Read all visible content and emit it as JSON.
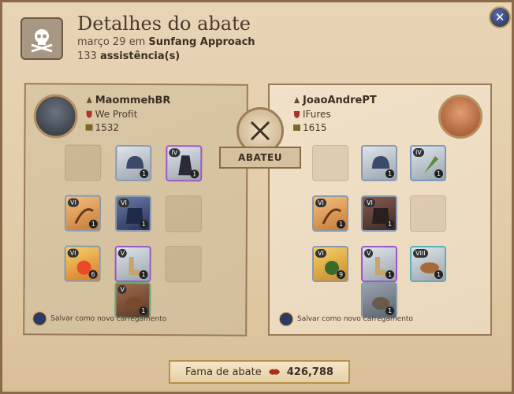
{
  "header": {
    "title": "Detalhes do abate",
    "date": "março 29",
    "date_prefix_sep": " em ",
    "location": "Sunfang Approach",
    "assists_count": "133",
    "assists_label": "assistência(s)",
    "icon": "skull-crossbones-icon"
  },
  "close_icon": "close-icon",
  "killer": {
    "name": "MaommehBR",
    "guild": "We Profit",
    "ip": "1532",
    "save_label": "Salvar como novo carregamento",
    "slots": [
      {
        "slot": "bag",
        "empty": true
      },
      {
        "slot": "head",
        "tier": "",
        "qty": "1",
        "icon": "helmet-icon"
      },
      {
        "slot": "cape",
        "tier": "IV",
        "qty": "1",
        "icon": "cape-icon",
        "rarity": "purple"
      },
      {
        "slot": "mainhand",
        "tier": "VI",
        "qty": "1",
        "icon": "crossbow-icon"
      },
      {
        "slot": "chest",
        "tier": "VI",
        "qty": "1",
        "icon": "armor-icon"
      },
      {
        "slot": "offhand",
        "empty": true
      },
      {
        "slot": "potion",
        "tier": "VI",
        "qty": "6",
        "icon": "potion-icon"
      },
      {
        "slot": "shoes",
        "tier": "V",
        "qty": "1",
        "icon": "boots-icon"
      },
      {
        "slot": "food",
        "empty": true
      },
      {
        "slot": "mount",
        "tier": "V",
        "qty": "1",
        "icon": "mount-icon"
      }
    ]
  },
  "victim": {
    "name": "JoaoAndrePT",
    "guild": "IFures",
    "ip": "1615",
    "save_label": "Salvar como novo carregamento",
    "slots": [
      {
        "slot": "bag",
        "empty": true
      },
      {
        "slot": "head",
        "tier": "",
        "qty": "1",
        "icon": "helmet-icon"
      },
      {
        "slot": "cape",
        "tier": "IV",
        "qty": "1",
        "icon": "cape-icon"
      },
      {
        "slot": "mainhand",
        "tier": "VI",
        "qty": "1",
        "icon": "crossbow-icon"
      },
      {
        "slot": "chest",
        "tier": "VI",
        "qty": "1",
        "icon": "armor-icon"
      },
      {
        "slot": "offhand",
        "empty": true
      },
      {
        "slot": "potion",
        "tier": "VI",
        "qty": "9",
        "icon": "potion-icon"
      },
      {
        "slot": "shoes",
        "tier": "V",
        "qty": "1",
        "icon": "boots-icon"
      },
      {
        "slot": "food",
        "tier": "VIII",
        "qty": "1",
        "icon": "food-icon"
      },
      {
        "slot": "mount",
        "tier": "",
        "qty": "1",
        "icon": "mount-icon"
      }
    ]
  },
  "killed_label": "ABATEU",
  "killed_icon": "crossed-swords-icon",
  "fame": {
    "label": "Fama de abate",
    "value": "426,788",
    "icon": "fame-icon"
  },
  "colors": {
    "background": "#e2cba8",
    "panel_left": "#d6c3a2",
    "panel_right": "#eedec3",
    "accent_gold": "#c9a04a",
    "rare_purple": "#9b58c8"
  }
}
